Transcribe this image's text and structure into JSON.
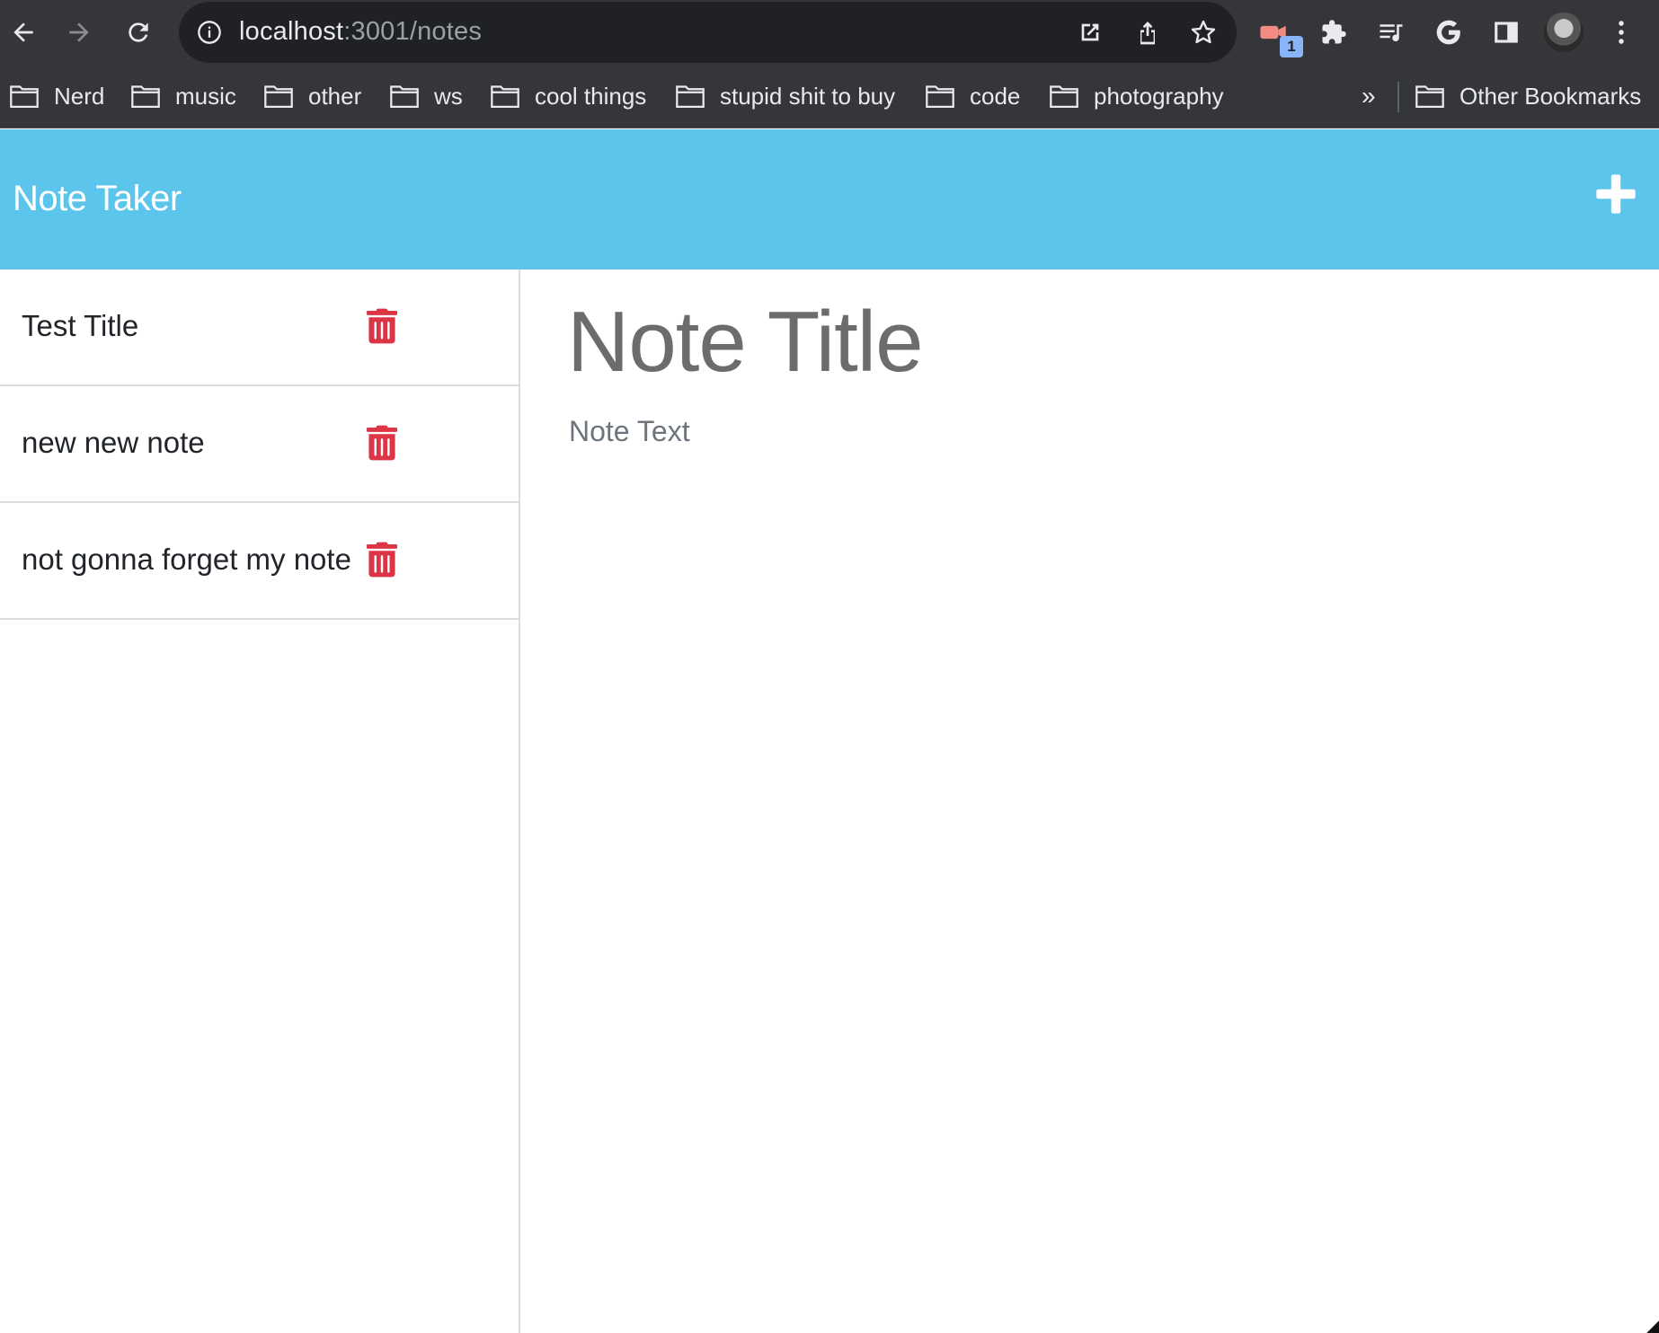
{
  "browser": {
    "url_host": "localhost",
    "url_path": ":3001/notes",
    "extension_badge": "1",
    "bookmarks": [
      {
        "label": "Nerd"
      },
      {
        "label": "music"
      },
      {
        "label": "other"
      },
      {
        "label": "ws"
      },
      {
        "label": "cool things"
      },
      {
        "label": "stupid shit to buy"
      },
      {
        "label": "code"
      },
      {
        "label": "photography"
      }
    ],
    "overflow": "»",
    "other_bookmarks": "Other Bookmarks"
  },
  "app": {
    "title": "Note Taker",
    "accent_color": "#5bc5eb",
    "delete_color": "#dc3545"
  },
  "notes": [
    {
      "title": "Test Title"
    },
    {
      "title": "new new note"
    },
    {
      "title": "not gonna forget my note"
    }
  ],
  "editor": {
    "title_placeholder": "Note Title",
    "text_placeholder": "Note Text"
  }
}
